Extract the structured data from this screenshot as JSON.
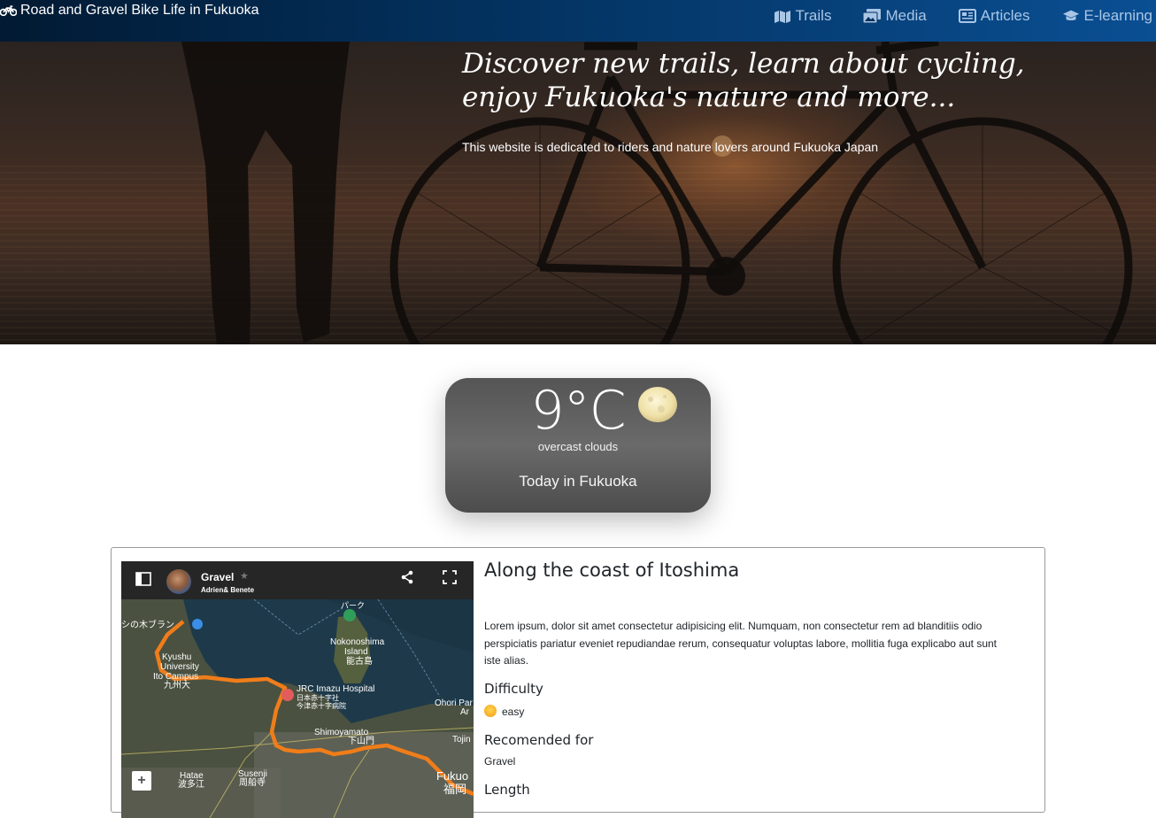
{
  "navbar": {
    "brand": "Road and Gravel Bike Life in Fukuoka",
    "brand_icon": "motorcycle-icon",
    "links": [
      {
        "label": "Trails",
        "icon": "map-icon"
      },
      {
        "label": "Media",
        "icon": "images-icon"
      },
      {
        "label": "Articles",
        "icon": "newspaper-icon"
      },
      {
        "label": "E-learning",
        "icon": "graduation-cap-icon"
      }
    ]
  },
  "hero": {
    "title": "Discover new trails, learn about cycling, enjoy Fukuoka's nature and more...",
    "subtitle": "This website is dedicated to riders and nature lovers around Fukuoka Japan"
  },
  "weather": {
    "temperature": "9°C",
    "description": "overcast clouds",
    "location": "Today in Fukuoka",
    "icon": "moon-icon"
  },
  "trail_card": {
    "map": {
      "name": "Gravel",
      "author": "Adrien& Benete",
      "zoom_in": "+",
      "labels": {
        "nokonoshima": "Nokonoshima",
        "island": "Island",
        "nokonoshima_jp": "能古島",
        "kyushu1": "Kyushu",
        "kyushu2": "University",
        "kyushu3": "Ito Campus",
        "kyushu_jp": "九州大",
        "jrc": "JRC Imazu Hospital",
        "jrc_jp1": "日本赤十字社",
        "jrc_jp2": "今津赤十字病院",
        "shimoyamato": "Shimoyamato",
        "shimoyamato_jp": "下山門",
        "ohori": "Ohori Par",
        "ohori2": "Ar",
        "tojin": "Tojin",
        "fukuoka": "Fukuo",
        "fukuoka_jp": "福岡",
        "hatae": "Hatae",
        "hatae_jp": "波多江",
        "susenji": "Susenji",
        "susenji_jp": "周船寺",
        "top_left_jp": "シの木ブラン",
        "park": "パーク"
      }
    },
    "title": "Along the coast of Itoshima",
    "text": "Lorem ipsum, dolor sit amet consectetur adipisicing elit. Numquam, non consectetur rem ad blanditiis odio perspiciatis pariatur eveniet repudiandae rerum, consequatur voluptas labore, mollitia fuga explicabo aut sunt iste alias.",
    "difficulty_label": "Difficulty",
    "difficulty_value": "easy",
    "recommended_label": "Recomended for",
    "recommended_value": "Gravel",
    "length_label": "Length"
  },
  "colors": {
    "navbar_start": "#021a33",
    "navbar_end": "#0a4f93",
    "nav_link": "#a9c6e6",
    "route": "#f07d1a",
    "weather_card": "#5e5e5e"
  }
}
